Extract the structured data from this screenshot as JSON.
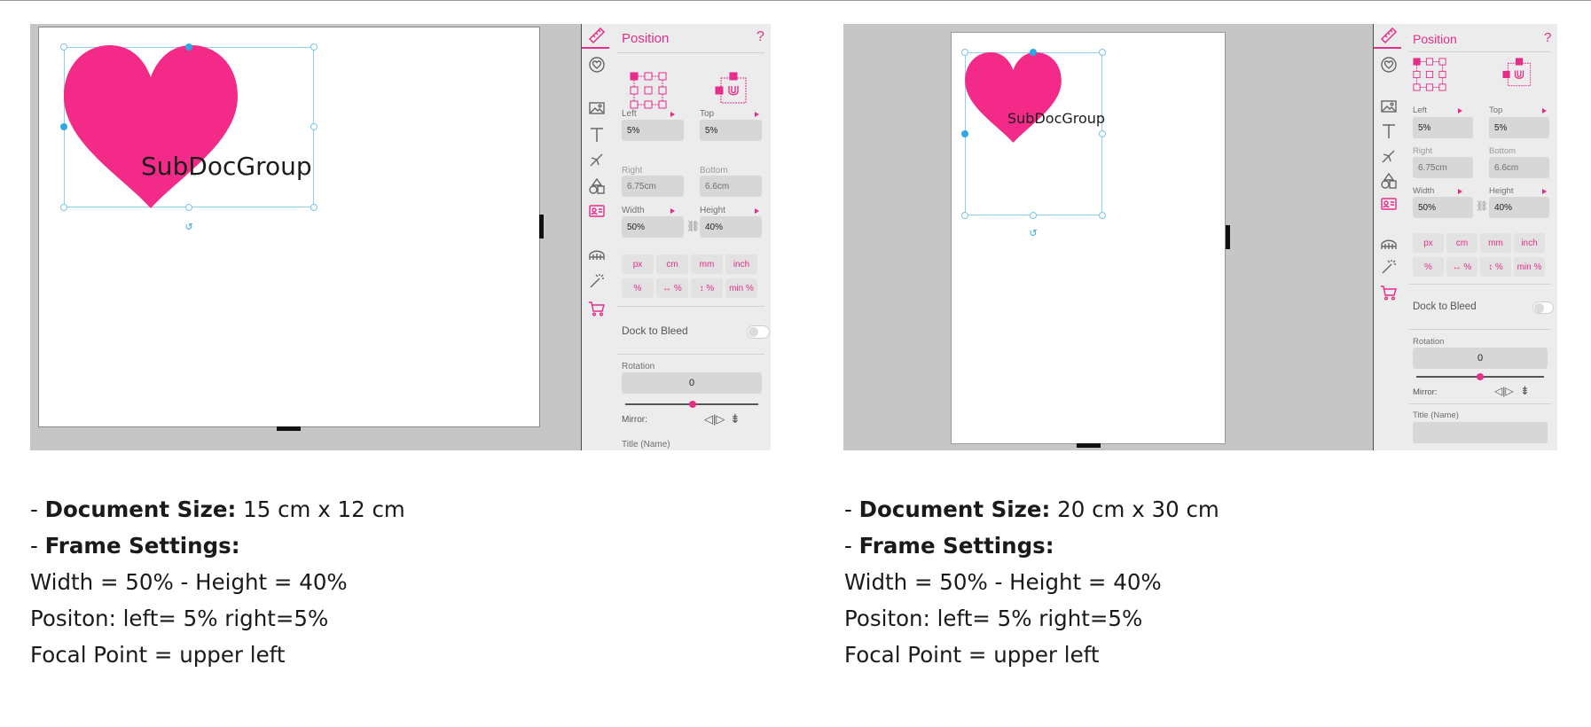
{
  "screens": [
    {
      "canvas_text": "SubDocGroup",
      "panel": {
        "title": "Position",
        "help_glyph": "?",
        "left_label": "Left",
        "left_value": "5%",
        "top_label": "Top",
        "top_value": "5%",
        "right_label": "Right",
        "right_value": "6.75cm",
        "bottom_label": "Bottom",
        "bottom_value": "6.6cm",
        "width_label": "Width",
        "width_value": "50%",
        "height_label": "Height",
        "height_value": "40%",
        "units_row1": [
          "px",
          "cm",
          "mm",
          "inch"
        ],
        "units_row2": [
          "%",
          "↔ %",
          "↕ %",
          "min %"
        ],
        "dock_label": "Dock to Bleed",
        "rotation_label": "Rotation",
        "rotation_value": "0",
        "mirror_label": "Mirror:",
        "title_name_label": "Title (Name)"
      },
      "description": {
        "doc_size_label": "Document Size:",
        "doc_size_value": "15 cm x 12 cm",
        "frame_settings_label": "Frame Settings:",
        "line_size": "Width = 50% - Height = 40%",
        "line_position": "Positon: left= 5% right=5%",
        "line_focal": "Focal Point = upper left"
      }
    },
    {
      "canvas_text": "SubDocGroup",
      "panel": {
        "title": "Position",
        "help_glyph": "?",
        "left_label": "Left",
        "left_value": "5%",
        "top_label": "Top",
        "top_value": "5%",
        "right_label": "Right",
        "right_value": "6.75cm",
        "bottom_label": "Bottom",
        "bottom_value": "6.6cm",
        "width_label": "Width",
        "width_value": "50%",
        "height_label": "Height",
        "height_value": "40%",
        "units_row1": [
          "px",
          "cm",
          "mm",
          "inch"
        ],
        "units_row2": [
          "%",
          "↔ %",
          "↕ %",
          "min %"
        ],
        "dock_label": "Dock to Bleed",
        "rotation_label": "Rotation",
        "rotation_value": "0",
        "mirror_label": "Mirror:",
        "title_name_label": "Title (Name)"
      },
      "description": {
        "doc_size_label": "Document Size:",
        "doc_size_value": "20 cm x 30 cm",
        "frame_settings_label": "Frame Settings:",
        "line_size": "Width = 50% - Height = 40%",
        "line_position": "Positon: left= 5% right=5%",
        "line_focal": "Focal Point = upper left"
      }
    }
  ],
  "colors": {
    "accent": "#e62d8a",
    "heart": "#f42a88",
    "selection": "#2da7e6",
    "workspace": "#c6c6c6",
    "panel_bg": "#ececec"
  },
  "icons": [
    "ruler-icon",
    "heart-badge-icon",
    "image-icon",
    "text-icon",
    "pen-tool-icon",
    "shapes-icon",
    "contact-card-icon",
    "bridge-icon",
    "magic-wand-icon",
    "cart-icon",
    "help-icon",
    "link-icon",
    "mirror-horizontal-icon",
    "mirror-vertical-icon",
    "rotate-icon"
  ]
}
